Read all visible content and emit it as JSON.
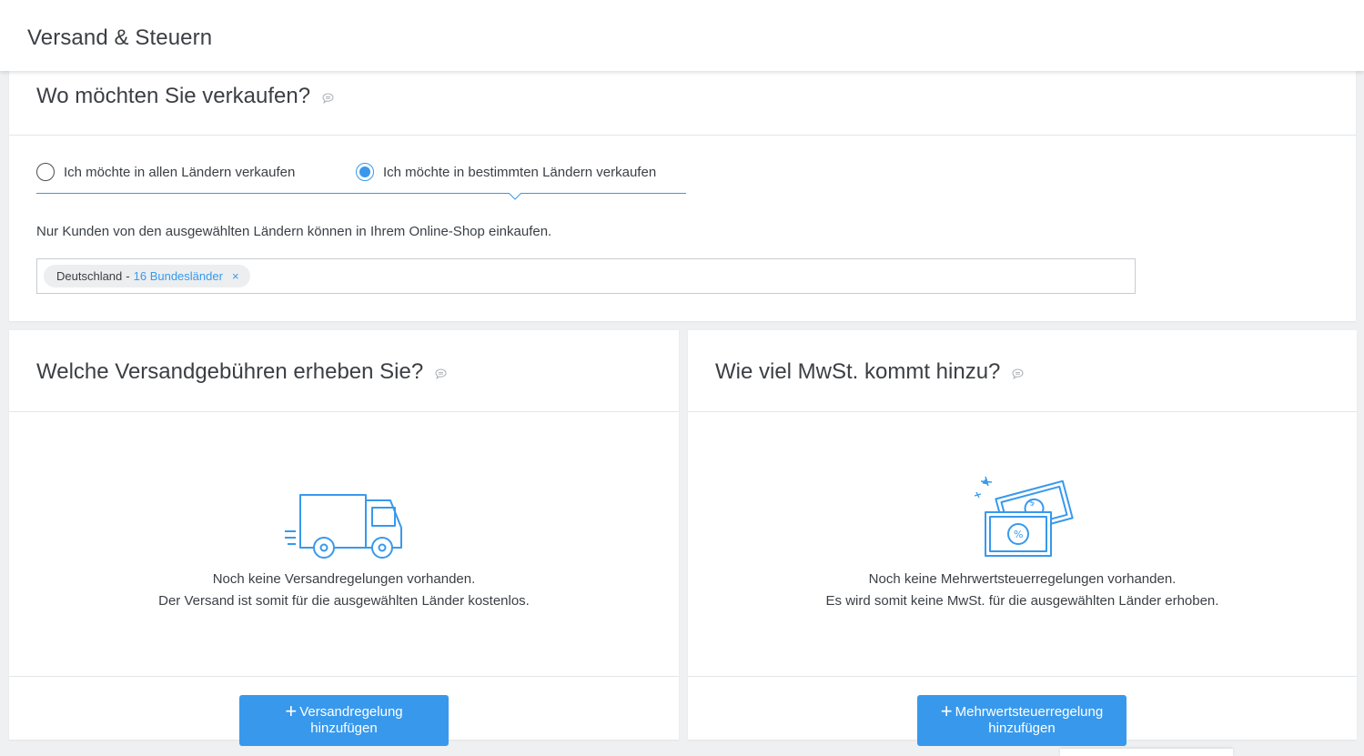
{
  "header": {
    "title": "Versand & Steuern"
  },
  "sell_section": {
    "title": "Wo möchten Sie verkaufen?",
    "options": [
      {
        "label": "Ich möchte in allen Ländern verkaufen",
        "selected": false
      },
      {
        "label": "Ich möchte in bestimmten Ländern verkaufen",
        "selected": true
      }
    ],
    "hint": "Nur Kunden von den ausgewählten Ländern können in Ihrem Online-Shop einkaufen.",
    "chip": {
      "country": "Deutschland",
      "separator": "-",
      "regions": "16 Bundesländer",
      "remove": "×"
    }
  },
  "shipping": {
    "title": "Welche Versandgebühren erheben Sie?",
    "empty_line1": "Noch keine Versandregelungen vorhanden.",
    "empty_line2": "Der Versand ist somit für die ausgewählten Länder kostenlos.",
    "button_line1": "Versandregelung",
    "button_line2": "hinzufügen",
    "button_plus": "+"
  },
  "tax": {
    "title": "Wie viel MwSt. kommt hinzu?",
    "empty_line1": "Noch keine Mehrwertsteuerregelungen vorhanden.",
    "empty_line2": "Es wird somit keine MwSt. für die ausgewählten Länder erhoben.",
    "button_line1": "Mehrwertsteuerregelung",
    "button_line2": "hinzufügen",
    "button_plus": "+",
    "illustration_symbols": {
      "front": "%",
      "back": "$"
    }
  },
  "colors": {
    "accent": "#3899ec",
    "text": "#3b3f44",
    "divider": "#e3e6e8",
    "background": "#eef0f2"
  },
  "icons": {
    "info": "speech-bubble-info-icon",
    "truck": "truck-illustration",
    "tax": "banknotes-illustration"
  }
}
